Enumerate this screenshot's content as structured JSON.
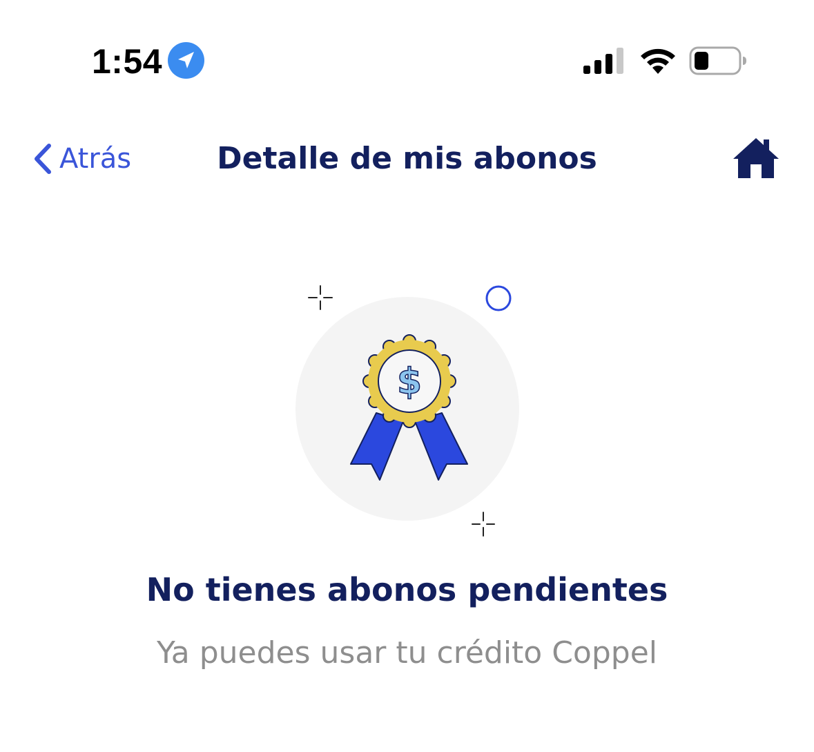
{
  "status_bar": {
    "time": "1:54",
    "location_icon": "location-arrow-icon",
    "signal_icon": "cellular-signal-icon",
    "wifi_icon": "wifi-icon",
    "battery_icon": "battery-icon",
    "signal_bars_active": 3,
    "signal_bars_total": 4,
    "battery_level": 0.2
  },
  "nav": {
    "back_label": "Atrás",
    "title": "Detalle de mis abonos",
    "home_icon": "home-icon"
  },
  "empty_state": {
    "illustration_icon": "award-ribbon-icon",
    "title": "No tienes abonos pendientes",
    "subtitle": "Ya puedes usar tu crédito Coppel"
  },
  "colors": {
    "accent": "#3a55d9",
    "navy": "#13205e",
    "location_badge": "#3b8cf0",
    "medal_gold": "#e8cb4e",
    "ribbon_blue": "#2b48de",
    "subtitle_gray": "#8e8e8e",
    "illustration_bg": "#f4f4f4"
  }
}
